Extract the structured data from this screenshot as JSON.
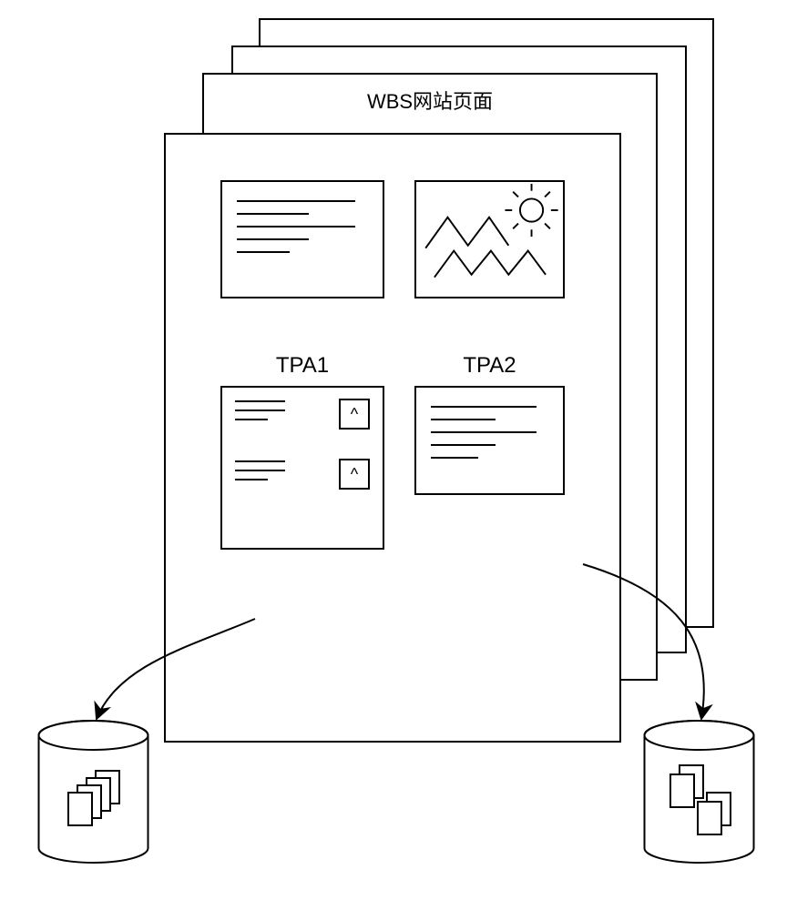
{
  "page_title": "WBS网站页面",
  "tpa1_label": "TPA1",
  "tpa2_label": "TPA2",
  "icons": {
    "up_arrow": "^",
    "text_tile": "text-lines-icon",
    "image_tile": "sun-mountains-icon",
    "cylinder": "database-icon"
  }
}
